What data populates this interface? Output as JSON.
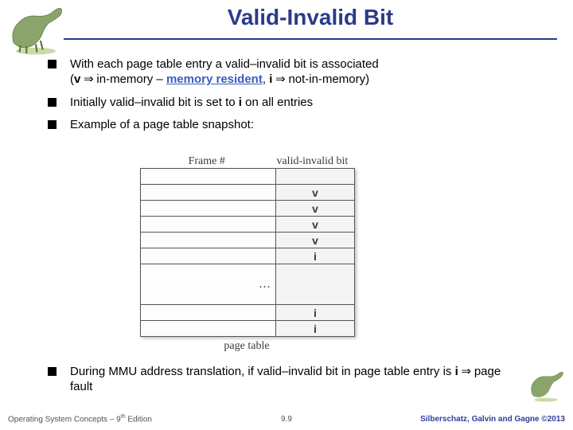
{
  "title": "Valid-Invalid Bit",
  "bullets": {
    "b1a": "With each page table entry a valid–invalid bit is associated",
    "b1b_open": "(",
    "b1b_v": "v",
    "b1b_arr1": " ⇒ ",
    "b1b_mid1": "in-memory – ",
    "b1b_memres": "memory resident",
    "b1b_comma": ", ",
    "b1b_i": "i",
    "b1b_arr2": " ⇒ ",
    "b1b_end": "not-in-memory)",
    "b2a": "Initially valid–invalid bit is set to ",
    "b2b": "i",
    "b2c": " on all entries",
    "b3": "Example of a page table snapshot:",
    "b4a": "During MMU address translation, if valid–invalid bit in page table entry is ",
    "b4b": "i",
    "b4c": " ⇒ ",
    "b4d": "page fault"
  },
  "figure": {
    "label_frame": "Frame #",
    "label_vi": "valid-invalid bit",
    "rows": [
      {
        "bit": ""
      },
      {
        "bit": "v"
      },
      {
        "bit": "v"
      },
      {
        "bit": "v"
      },
      {
        "bit": "v"
      },
      {
        "bit": "i"
      },
      {
        "bit": "",
        "dots": "…"
      },
      {
        "bit": "i"
      },
      {
        "bit": "i"
      }
    ],
    "caption": "page table"
  },
  "footer": {
    "left_a": "Operating System Concepts – 9",
    "left_b": " Edition",
    "center": "9.9",
    "right": "Silberschatz, Galvin and Gagne ©2013"
  }
}
